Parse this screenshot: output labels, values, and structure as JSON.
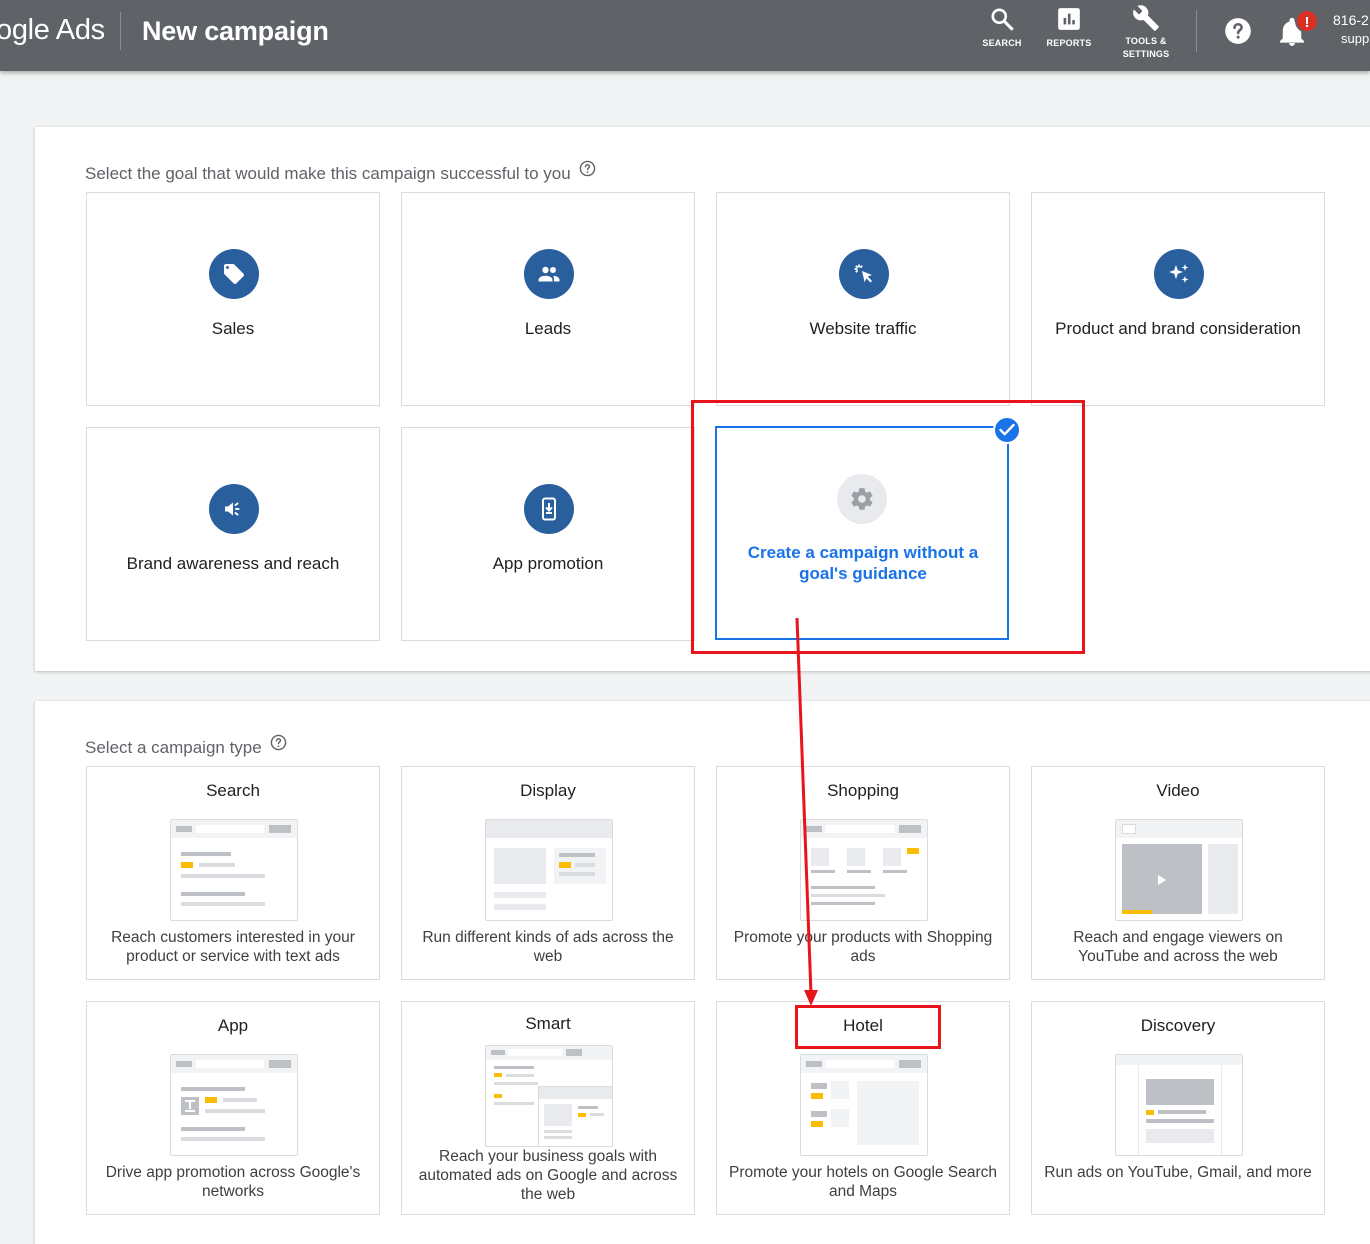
{
  "header": {
    "brand": "ogle Ads",
    "page_title": "New campaign",
    "tools": [
      {
        "label": "SEARCH",
        "icon": "search-icon"
      },
      {
        "label": "REPORTS",
        "icon": "reports-icon"
      },
      {
        "label_line1": "TOOLS &",
        "label_line2": "SETTINGS",
        "icon": "wrench-icon"
      }
    ],
    "notification_badge": "!",
    "account_id": "816-2",
    "account_sub": "supp"
  },
  "goals": {
    "label": "Select the goal that would make this campaign successful to you",
    "items": [
      {
        "label": "Sales",
        "icon": "tag-icon"
      },
      {
        "label": "Leads",
        "icon": "people-icon"
      },
      {
        "label": "Website traffic",
        "icon": "cursor-click-icon"
      },
      {
        "label": "Product and brand consideration",
        "icon": "sparkle-icon"
      },
      {
        "label": "Brand awareness and reach",
        "icon": "megaphone-icon"
      },
      {
        "label": "App promotion",
        "icon": "phone-download-icon"
      }
    ],
    "selected": {
      "label": "Create a campaign without a goal's guidance",
      "icon": "gear-icon"
    }
  },
  "campaign_types": {
    "label": "Select a campaign type",
    "items": [
      {
        "title": "Search",
        "desc": "Reach customers interested in your product or service with text ads"
      },
      {
        "title": "Display",
        "desc": "Run different kinds of ads across the web"
      },
      {
        "title": "Shopping",
        "desc": "Promote your products with Shopping ads"
      },
      {
        "title": "Video",
        "desc": "Reach and engage viewers on YouTube and across the web"
      },
      {
        "title": "App",
        "desc": "Drive app promotion across Google's networks"
      },
      {
        "title": "Smart",
        "desc": "Reach your business goals with automated ads on Google and across the web"
      },
      {
        "title": "Hotel",
        "desc": "Promote your hotels on Google Search and Maps"
      },
      {
        "title": "Discovery",
        "desc": "Run ads on YouTube, Gmail, and more"
      }
    ]
  },
  "colors": {
    "header_bg": "#5f6368",
    "goal_icon_bg": "#2a5f9e",
    "accent_blue": "#1a73e8",
    "annotation_red": "#e8141c",
    "ad_yellow": "#fbbc04"
  }
}
